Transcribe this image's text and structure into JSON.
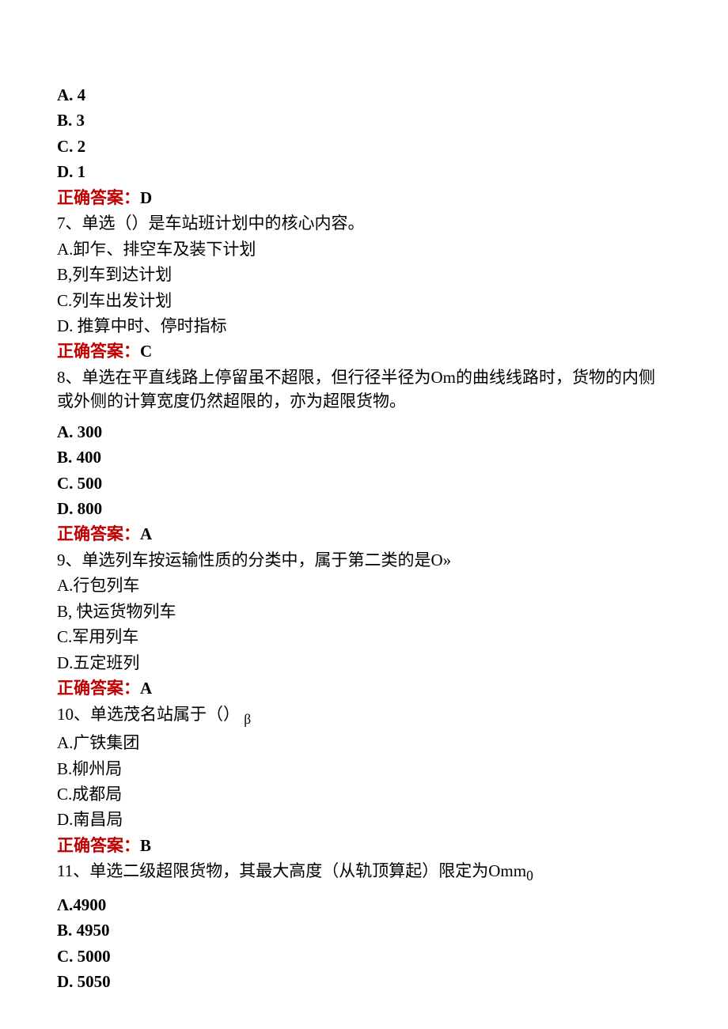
{
  "q6": {
    "optA": "A. 4",
    "optB": "B. 3",
    "optC": "C. 2",
    "optD": "D. 1",
    "ansLabel": "正确答案：",
    "ansValue": "D"
  },
  "q7": {
    "stem": "7、单选（）是车站班计划中的核心内容。",
    "optA": "A.卸乍、排空车及装下计划",
    "optB": "B,列车到达计划",
    "optC": "C.列车出发计划",
    "optD": "D. 推算中时、停时指标",
    "ansLabel": "正确答案：",
    "ansValue": "C"
  },
  "q8": {
    "stem": "8、单选在平直线路上停留虽不超限，但行径半径为Om的曲线线路时，货物的内侧或外侧的计算宽度仍然超限的，亦为超限货物。",
    "optA": "A. 300",
    "optB": "B. 400",
    "optC": "C. 500",
    "optD": "D. 800",
    "ansLabel": "正确答案：",
    "ansValue": "A"
  },
  "q9": {
    "stem": "9、单选列车按运输性质的分类中，属于第二类的是O»",
    "optA": "A.行包列车",
    "optB": "B, 快运货物列车",
    "optC": "C.军用列车",
    "optD": "D.五定班列",
    "ansLabel": "正确答案：",
    "ansValue": "A"
  },
  "q10": {
    "stem": "10、单选茂名站属于（）",
    "stemSub": "β",
    "optA": "A.广铁集团",
    "optB": "B.柳州局",
    "optC": "C.成都局",
    "optD": "D.南昌局",
    "ansLabel": "正确答案：",
    "ansValue": "B"
  },
  "q11": {
    "stem": "11、单选二级超限货物，其最大高度（从轨顶算起）限定为Omm",
    "stemSub": "0",
    "optA": "Λ.4900",
    "optB": "B. 4950",
    "optC": "C. 5000",
    "optD": "D. 5050"
  }
}
